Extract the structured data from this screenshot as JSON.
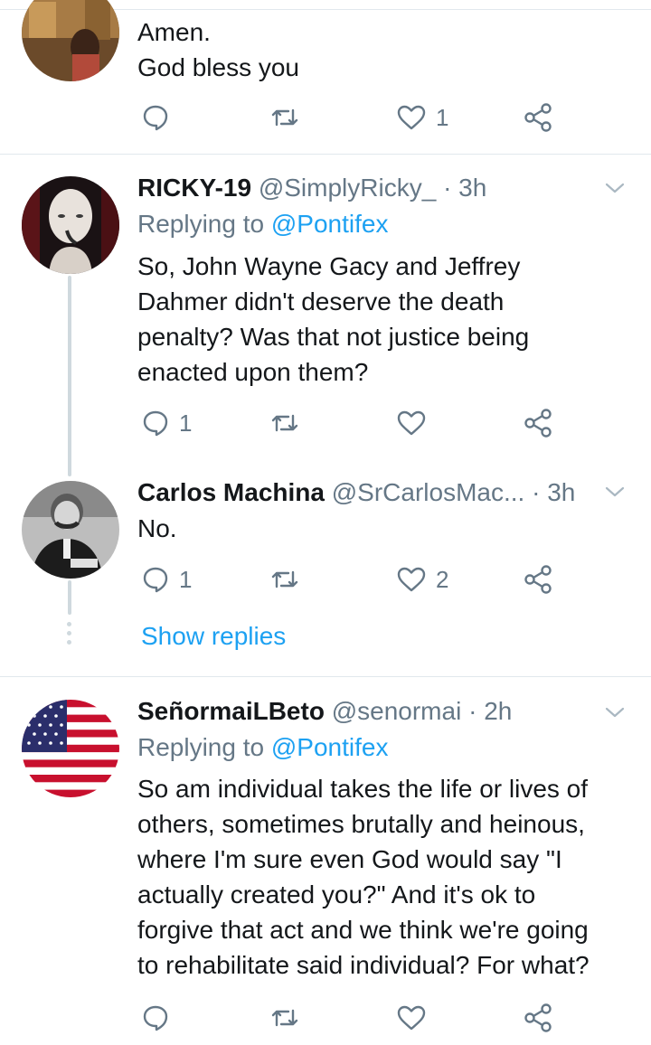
{
  "tweets": [
    {
      "body_lines": [
        "Amen.",
        "God bless you"
      ],
      "actions": {
        "reply_count": "",
        "retweet_count": "",
        "like_count": "1"
      }
    },
    {
      "name": "RICKY-19",
      "handle": "@SimplyRicky_",
      "separator": "·",
      "time": "3h",
      "replying_prefix": "Replying to",
      "replying_to": "@Pontifex",
      "body_lines": [
        "So, John Wayne Gacy and Jeffrey",
        "Dahmer didn't deserve the death",
        "penalty?  Was that not justice being",
        "enacted upon them?"
      ],
      "actions": {
        "reply_count": "1",
        "retweet_count": "",
        "like_count": ""
      }
    },
    {
      "name": "Carlos Machina",
      "handle": "@SrCarlosMac...",
      "separator": "·",
      "time": "3h",
      "body_lines": [
        "No."
      ],
      "actions": {
        "reply_count": "1",
        "retweet_count": "",
        "like_count": "2"
      }
    },
    {
      "name": "SeñormaiLBeto",
      "handle": "@senormai",
      "separator": "·",
      "time": "2h",
      "replying_prefix": "Replying to",
      "replying_to": "@Pontifex",
      "body_lines": [
        "So am individual takes the life or lives of",
        "others, sometimes brutally and heinous,",
        "where I'm sure even God would say \"I",
        "actually created you?\" And it's ok to",
        "forgive that act and we think we're going",
        "to rehabilitate said individual? For what?"
      ],
      "actions": {
        "reply_count": "",
        "retweet_count": "",
        "like_count": ""
      }
    }
  ],
  "show_replies_label": "Show replies",
  "icons": [
    "reply-icon",
    "retweet-icon",
    "like-icon",
    "share-icon",
    "chevron-down-icon"
  ],
  "colors": {
    "link": "#1da1f2",
    "muted": "#657786",
    "text": "#14171a",
    "divider": "#e1e8ed"
  }
}
